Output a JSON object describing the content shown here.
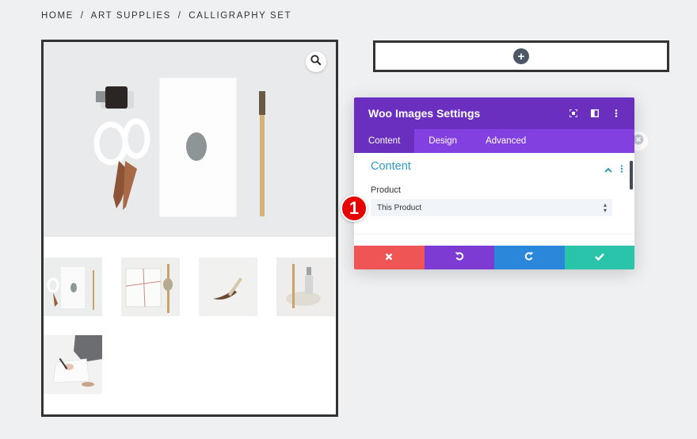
{
  "breadcrumb": {
    "home": "HOME",
    "sep": "/",
    "category": "ART SUPPLIES",
    "current": "CALLIGRAPHY SET"
  },
  "gallery": {
    "zoom_icon": "magnifier-icon",
    "thumbnails": [
      "calligraphy-set-flatlay",
      "wrapped-paper-pack",
      "brush-closeup",
      "ink-bottle-tray",
      "writing-hand"
    ]
  },
  "builder": {
    "add_icon": "plus-icon"
  },
  "modal": {
    "title": "Woo Images Settings",
    "header_icons": [
      "expand-icon",
      "columns-icon",
      "more-icon"
    ],
    "tabs": [
      "Content",
      "Design",
      "Advanced"
    ],
    "active_tab": "Content",
    "section": {
      "title": "Content",
      "field_label": "Product",
      "select_value": "This Product"
    },
    "footer": {
      "cancel_icon": "close-icon",
      "undo_icon": "undo-icon",
      "redo_icon": "redo-icon",
      "save_icon": "check-icon"
    },
    "colors": {
      "header": "#6b2fc0",
      "tabs": "#8340e1",
      "section_title": "#2e9ac8",
      "cancel": "#ef5555",
      "undo": "#7d3bd4",
      "redo": "#2b87da",
      "save": "#29c4a9"
    }
  },
  "annotation": {
    "step_number": "1"
  }
}
